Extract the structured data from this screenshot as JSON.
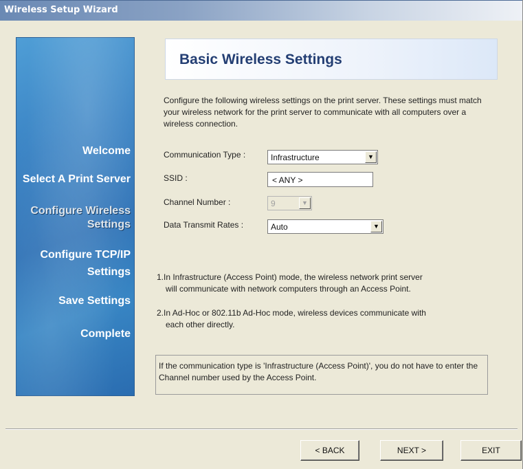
{
  "window": {
    "title": "Wireless Setup Wizard"
  },
  "sidebar": {
    "items": [
      {
        "label": "Welcome"
      },
      {
        "label": "Select A Print Server"
      },
      {
        "label_line1": "Configure Wireless",
        "label_line2": "Settings",
        "active": true
      },
      {
        "label_line1": "Configure TCP/IP",
        "label_line2": "Settings"
      },
      {
        "label": "Save Settings"
      },
      {
        "label": "Complete"
      }
    ]
  },
  "header": {
    "title": "Basic Wireless Settings"
  },
  "intro": "Configure the following wireless settings on the print server. These settings must match your wireless network for the print server to communicate with all computers over a wireless connection.",
  "form": {
    "communication_type": {
      "label": "Communication Type :",
      "value": "Infrastructure"
    },
    "ssid": {
      "label": "SSID :",
      "value": "< ANY >"
    },
    "channel_number": {
      "label": "Channel Number :",
      "value": "9",
      "disabled": true
    },
    "data_transmit_rates": {
      "label": "Data Transmit Rates :",
      "value": "Auto"
    }
  },
  "notes": {
    "note1_line1": "1.In Infrastructure (Access Point) mode, the wireless network print server",
    "note1_line2": "will communicate with network computers through an Access Point.",
    "note2_line1": "2.In Ad-Hoc or 802.11b Ad-Hoc mode, wireless devices communicate with",
    "note2_line2": "each other directly."
  },
  "info": "If the communication type is 'Infrastructure (Access Point)', you do not have to enter the Channel number used by the Access Point.",
  "buttons": {
    "back": "< BACK",
    "next": "NEXT >",
    "exit": "EXIT"
  },
  "colors": {
    "sidebar_blue": "#3a83c4",
    "header_text": "#233e73",
    "dialog_bg": "#ece9d8"
  }
}
